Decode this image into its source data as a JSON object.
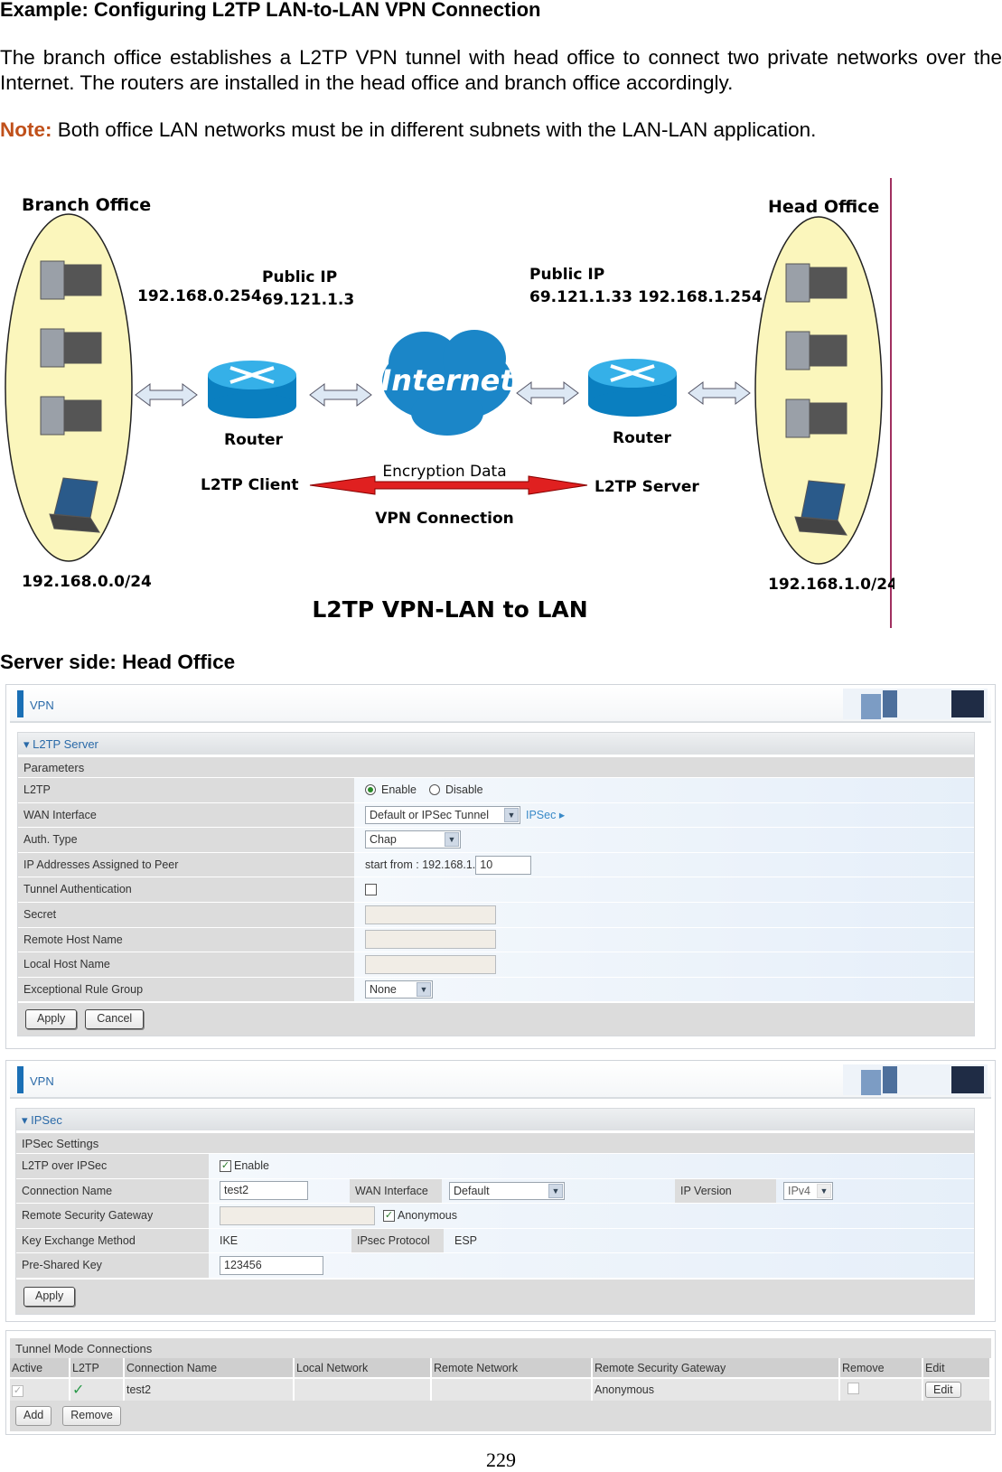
{
  "heading": "Example: Configuring L2TP LAN-to-LAN VPN Connection",
  "intro": "The branch office establishes a L2TP VPN tunnel with head office to connect two private networks over the Internet. The routers are installed in the head office and branch office accordingly.",
  "note": {
    "label": "Note:",
    "text": " Both office LAN networks must be in different subnets with the LAN-LAN application.",
    "color": "#c0501a"
  },
  "diagram": {
    "branch_title": "Branch Office",
    "head_title": "Head Office",
    "branch_lan_ip": "192.168.0.254",
    "branch_public_label": "Public IP",
    "branch_public_ip": "69.121.1.3",
    "head_public_label": "Public IP",
    "head_public_ip": "69.121.1.33",
    "head_lan_ip": "192.168.1.254",
    "router_left": "Router",
    "router_right": "Router",
    "internet": "Internet",
    "client": "L2TP Client",
    "server": "L2TP Server",
    "encryption": "Encryption Data",
    "vpn": "VPN Connection",
    "branch_subnet": "192.168.0.0/24",
    "head_subnet": "192.168.1.0/24",
    "caption": "L2TP VPN-LAN to LAN"
  },
  "server_heading": "Server side: Head Office",
  "l2tp_panel": {
    "bar_title": "VPN",
    "section": "L2TP Server",
    "subsection": "Parameters",
    "rows": {
      "l2tp": {
        "label": "L2TP",
        "enable": "Enable",
        "disable": "Disable",
        "selected": "Enable"
      },
      "wan": {
        "label": "WAN Interface",
        "value": "Default or IPSec Tunnel",
        "link": "IPSec"
      },
      "auth": {
        "label": "Auth. Type",
        "value": "Chap"
      },
      "ip": {
        "label": "IP Addresses Assigned to Peer",
        "prefix": "start from : 192.168.1.",
        "value": "10"
      },
      "tunnel_auth": {
        "label": "Tunnel Authentication",
        "checked": false
      },
      "secret": {
        "label": "Secret",
        "value": ""
      },
      "remote_host": {
        "label": "Remote Host Name",
        "value": ""
      },
      "local_host": {
        "label": "Local Host Name",
        "value": ""
      },
      "rule_group": {
        "label": "Exceptional Rule Group",
        "value": "None"
      }
    },
    "apply": "Apply",
    "cancel": "Cancel"
  },
  "ipsec_panel": {
    "bar_title": "VPN",
    "section": "IPSec",
    "subsection": "IPSec Settings",
    "l2tp_over_ipsec": {
      "label": "L2TP over IPSec",
      "option": "Enable",
      "checked": true
    },
    "connection_name": {
      "label": "Connection Name",
      "value": "test2"
    },
    "wan": {
      "label": "WAN Interface",
      "value": "Default"
    },
    "ip_version": {
      "label": "IP Version",
      "value": "IPv4"
    },
    "gateway": {
      "label": "Remote Security Gateway",
      "value": "",
      "anonymous": "Anonymous",
      "checked": true
    },
    "key_exchange": {
      "label": "Key Exchange Method",
      "value": "IKE"
    },
    "protocol": {
      "label": "IPsec Protocol",
      "value": "ESP"
    },
    "psk": {
      "label": "Pre-Shared Key",
      "value": "123456"
    },
    "apply": "Apply"
  },
  "tunnel_table": {
    "title": "Tunnel Mode Connections",
    "columns": [
      "Active",
      "L2TP",
      "Connection Name",
      "Local Network",
      "Remote Network",
      "Remote Security Gateway",
      "Remove",
      "Edit"
    ],
    "rows": [
      {
        "active": true,
        "l2tp": "✓",
        "name": "test2",
        "local": "",
        "remote": "",
        "gateway": "Anonymous",
        "remove": false,
        "edit": "Edit"
      }
    ],
    "add": "Add",
    "remove": "Remove"
  },
  "page_number": "229"
}
